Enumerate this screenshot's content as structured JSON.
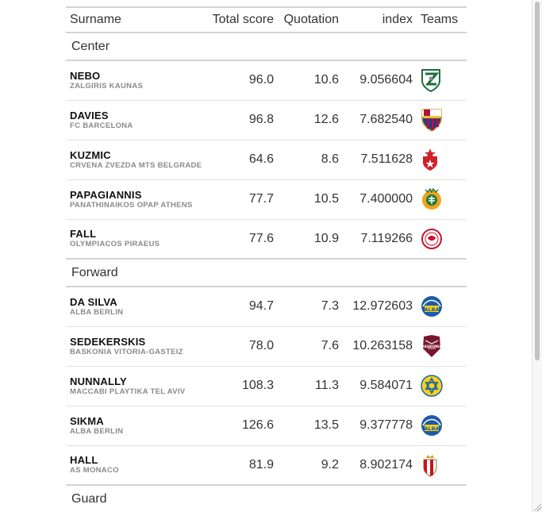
{
  "table": {
    "headers": [
      "Surname",
      "Total score",
      "Quotation",
      "index",
      "Teams"
    ],
    "groups": [
      {
        "label": "Center",
        "rows": [
          {
            "surname": "NEBO",
            "team": "ZALGIRIS KAUNAS",
            "total_score": "96.0",
            "quotation": "10.6",
            "index": "9.056604",
            "logo_icon": "zalgiris-logo-icon"
          },
          {
            "surname": "DAVIES",
            "team": "FC BARCELONA",
            "total_score": "96.8",
            "quotation": "12.6",
            "index": "7.682540",
            "logo_icon": "barcelona-logo-icon"
          },
          {
            "surname": "KUZMIC",
            "team": "CRVENA ZVEZDA MTS BELGRADE",
            "total_score": "64.6",
            "quotation": "8.6",
            "index": "7.511628",
            "logo_icon": "crvena-zvezda-logo-icon"
          },
          {
            "surname": "PAPAGIANNIS",
            "team": "PANATHINAIKOS OPAP ATHENS",
            "total_score": "77.7",
            "quotation": "10.5",
            "index": "7.400000",
            "logo_icon": "panathinaikos-logo-icon"
          },
          {
            "surname": "FALL",
            "team": "OLYMPIACOS PIRAEUS",
            "total_score": "77.6",
            "quotation": "10.9",
            "index": "7.119266",
            "logo_icon": "olympiacos-logo-icon"
          }
        ]
      },
      {
        "label": "Forward",
        "rows": [
          {
            "surname": "DA SILVA",
            "team": "ALBA BERLIN",
            "total_score": "94.7",
            "quotation": "7.3",
            "index": "12.972603",
            "logo_icon": "alba-berlin-logo-icon"
          },
          {
            "surname": "SEDEKERSKIS",
            "team": "BASKONIA VITORIA-GASTEIZ",
            "total_score": "78.0",
            "quotation": "7.6",
            "index": "10.263158",
            "logo_icon": "baskonia-logo-icon"
          },
          {
            "surname": "NUNNALLY",
            "team": "MACCABI PLAYTIKA TEL AVIV",
            "total_score": "108.3",
            "quotation": "11.3",
            "index": "9.584071",
            "logo_icon": "maccabi-logo-icon"
          },
          {
            "surname": "SIKMA",
            "team": "ALBA BERLIN",
            "total_score": "126.6",
            "quotation": "13.5",
            "index": "9.377778",
            "logo_icon": "alba-berlin-logo-icon"
          },
          {
            "surname": "HALL",
            "team": "AS MONACO",
            "total_score": "81.9",
            "quotation": "9.2",
            "index": "8.902174",
            "logo_icon": "monaco-logo-icon"
          }
        ]
      },
      {
        "label": "Guard",
        "rows": []
      }
    ]
  },
  "logo_text": {
    "alba-berlin-logo-icon": "ALBA",
    "baskonia-logo-icon": "BASKONIA"
  },
  "colors": {
    "zalgiris": "#1b6e3a",
    "barcelona_blue": "#1f3f8f",
    "barcelona_red": "#b0123d",
    "zvezda_red": "#d0202a",
    "panathinaikos_green": "#1c7a3c",
    "panathinaikos_gold": "#f2a21b",
    "olympiacos_red": "#c9132b",
    "alba_blue": "#1e5aa8",
    "alba_yellow": "#f5d30f",
    "baskonia": "#7a1530",
    "maccabi_yellow": "#f3d11a",
    "maccabi_blue": "#1f62ad",
    "monaco_red": "#c4161c",
    "grid": "#d3d3d3"
  }
}
